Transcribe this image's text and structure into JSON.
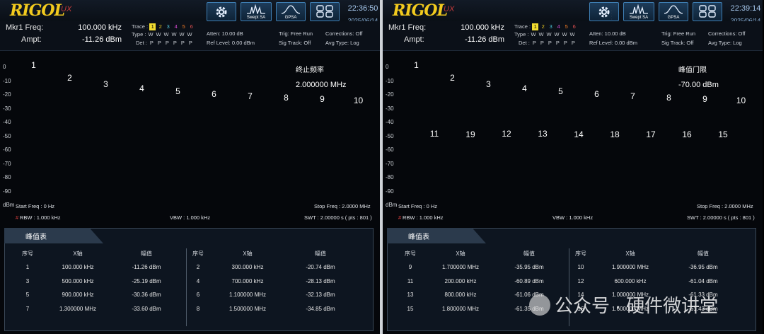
{
  "screens": [
    {
      "brand": "RIGOL",
      "brand_sub": "UX",
      "toolbar": [
        "",
        "Swept SA",
        "GPSA",
        ""
      ],
      "clock": "22:36:50",
      "date": "2025/06/14",
      "marker": {
        "freq_label": "Mkr1 Freq:",
        "freq_value": "100.000 kHz",
        "ampt_label": "Ampt:",
        "ampt_value": "-11.26 dBm"
      },
      "trace": {
        "label": "Trace :",
        "nums": [
          "1",
          "2",
          "3",
          "4",
          "5",
          "6"
        ],
        "type_label": "Type :",
        "type_vals": [
          "W",
          "W",
          "W",
          "W",
          "W",
          "W"
        ],
        "det_label": "Det :",
        "det_vals": [
          "P",
          "P",
          "P",
          "P",
          "P",
          "P"
        ]
      },
      "status": {
        "atten": "Atten: 10.00 dB",
        "ref": "Ref Level: 0.00 dBm",
        "trig": "Trig: Free Run",
        "sig": "Sig Track: Off",
        "corr": "Corrections: Off",
        "avg": "Avg Type: Log"
      },
      "annotation": {
        "title": "终止频率",
        "value": "2.000000 MHz"
      },
      "y_ticks": [
        "0",
        "-10",
        "-20",
        "-30",
        "-40",
        "-50",
        "-60",
        "-70",
        "-80",
        "-90",
        "dBm"
      ],
      "freq": {
        "start": "Start Freq : 0 Hz",
        "stop": "Stop Freq : 2.0000 MHz",
        "rbw": "RBW : 1.000 kHz",
        "vbw": "VBW : 1.000 kHz",
        "swt": "SWT : 2.00000 s ( pts : 801 )"
      },
      "table": {
        "title": "峰值表",
        "headers": [
          "序号",
          "X轴",
          "幅值",
          "序号",
          "X轴",
          "幅值"
        ],
        "rows": [
          [
            "1",
            "100.000 kHz",
            "-11.26 dBm",
            "2",
            "300.000 kHz",
            "-20.74 dBm"
          ],
          [
            "3",
            "500.000 kHz",
            "-25.19 dBm",
            "4",
            "700.000 kHz",
            "-28.13 dBm"
          ],
          [
            "5",
            "900.000 kHz",
            "-30.36 dBm",
            "6",
            "1.100000 MHz",
            "-32.13 dBm"
          ],
          [
            "7",
            "1.300000 MHz",
            "-33.60 dBm",
            "8",
            "1.500000 MHz",
            "-34.85 dBm"
          ]
        ]
      },
      "peaks": [
        {
          "label": "1",
          "freq_khz": 100,
          "dbm": -11.26
        },
        {
          "label": "2",
          "freq_khz": 300,
          "dbm": -20.74
        },
        {
          "label": "3",
          "freq_khz": 500,
          "dbm": -25.19
        },
        {
          "label": "4",
          "freq_khz": 700,
          "dbm": -28.13
        },
        {
          "label": "5",
          "freq_khz": 900,
          "dbm": -30.36
        },
        {
          "label": "6",
          "freq_khz": 1100,
          "dbm": -32.13
        },
        {
          "label": "7",
          "freq_khz": 1300,
          "dbm": -33.6
        },
        {
          "label": "8",
          "freq_khz": 1500,
          "dbm": -34.85
        },
        {
          "label": "9",
          "freq_khz": 1700,
          "dbm": -35.95
        },
        {
          "label": "10",
          "freq_khz": 1900,
          "dbm": -36.95
        }
      ]
    },
    {
      "brand": "RIGOL",
      "brand_sub": "UX",
      "toolbar": [
        "",
        "Swept SA",
        "GPSA",
        ""
      ],
      "clock": "22:39:14",
      "date": "2025/06/14",
      "marker": {
        "freq_label": "Mkr1 Freq:",
        "freq_value": "100.000 kHz",
        "ampt_label": "Ampt:",
        "ampt_value": "-11.26 dBm"
      },
      "trace": {
        "label": "Trace :",
        "nums": [
          "1",
          "2",
          "3",
          "4",
          "5",
          "6"
        ],
        "type_label": "Type :",
        "type_vals": [
          "W",
          "W",
          "W",
          "W",
          "W",
          "W"
        ],
        "det_label": "Det :",
        "det_vals": [
          "P",
          "P",
          "P",
          "P",
          "P",
          "P"
        ]
      },
      "status": {
        "atten": "Atten: 10.00 dB",
        "ref": "Ref Level: 0.00 dBm",
        "trig": "Trig: Free Run",
        "sig": "Sig Track: Off",
        "corr": "Corrections: Off",
        "avg": "Avg Type: Log"
      },
      "annotation": {
        "title": "峰值门限",
        "value": "-70.00 dBm"
      },
      "y_ticks": [
        "0",
        "-10",
        "-20",
        "-30",
        "-40",
        "-50",
        "-60",
        "-70",
        "-80",
        "-90",
        "dBm"
      ],
      "freq": {
        "start": "Start Freq : 0 Hz",
        "stop": "Stop Freq : 2.0000 MHz",
        "rbw": "RBW : 1.000 kHz",
        "vbw": "VBW : 1.000 kHz",
        "swt": "SWT : 2.00000 s ( pts : 801 )"
      },
      "table": {
        "title": "峰值表",
        "headers": [
          "序号",
          "X轴",
          "幅值",
          "序号",
          "X轴",
          "幅值"
        ],
        "rows": [
          [
            "9",
            "1.700000 MHz",
            "-35.95 dBm",
            "10",
            "1.900000 MHz",
            "-36.95 dBm"
          ],
          [
            "11",
            "200.000 kHz",
            "-60.89 dBm",
            "12",
            "600.000 kHz",
            "-61.04 dBm"
          ],
          [
            "13",
            "800.000 kHz",
            "-61.06 dBm",
            "14",
            "1.000000 MHz",
            "-61.33 dBm"
          ],
          [
            "15",
            "1.800000 MHz",
            "-61.35 dBm",
            "16",
            "1.600000 MHz",
            "-61.43 dBm"
          ]
        ]
      },
      "peaks": [
        {
          "label": "1",
          "freq_khz": 100,
          "dbm": -11.26
        },
        {
          "label": "11",
          "freq_khz": 200,
          "dbm": -60.89
        },
        {
          "label": "2",
          "freq_khz": 300,
          "dbm": -20.74
        },
        {
          "label": "19",
          "freq_khz": 400,
          "dbm": -61.6
        },
        {
          "label": "3",
          "freq_khz": 500,
          "dbm": -25.19
        },
        {
          "label": "12",
          "freq_khz": 600,
          "dbm": -61.04
        },
        {
          "label": "4",
          "freq_khz": 700,
          "dbm": -28.13
        },
        {
          "label": "13",
          "freq_khz": 800,
          "dbm": -61.06
        },
        {
          "label": "5",
          "freq_khz": 900,
          "dbm": -30.36
        },
        {
          "label": "14",
          "freq_khz": 1000,
          "dbm": -61.33
        },
        {
          "label": "6",
          "freq_khz": 1100,
          "dbm": -32.13
        },
        {
          "label": "18",
          "freq_khz": 1200,
          "dbm": -61.55
        },
        {
          "label": "7",
          "freq_khz": 1300,
          "dbm": -33.6
        },
        {
          "label": "17",
          "freq_khz": 1400,
          "dbm": -61.5
        },
        {
          "label": "8",
          "freq_khz": 1500,
          "dbm": -34.85
        },
        {
          "label": "16",
          "freq_khz": 1600,
          "dbm": -61.43
        },
        {
          "label": "9",
          "freq_khz": 1700,
          "dbm": -35.95
        },
        {
          "label": "15",
          "freq_khz": 1800,
          "dbm": -61.35
        },
        {
          "label": "10",
          "freq_khz": 1900,
          "dbm": -36.95
        }
      ]
    }
  ],
  "watermark": "公众号 · 硬件微讲堂",
  "colors": {
    "trace": "#f0e030",
    "marker": "#39d34a",
    "grid": "#3a4350",
    "accent": "#f2ca1e"
  }
}
